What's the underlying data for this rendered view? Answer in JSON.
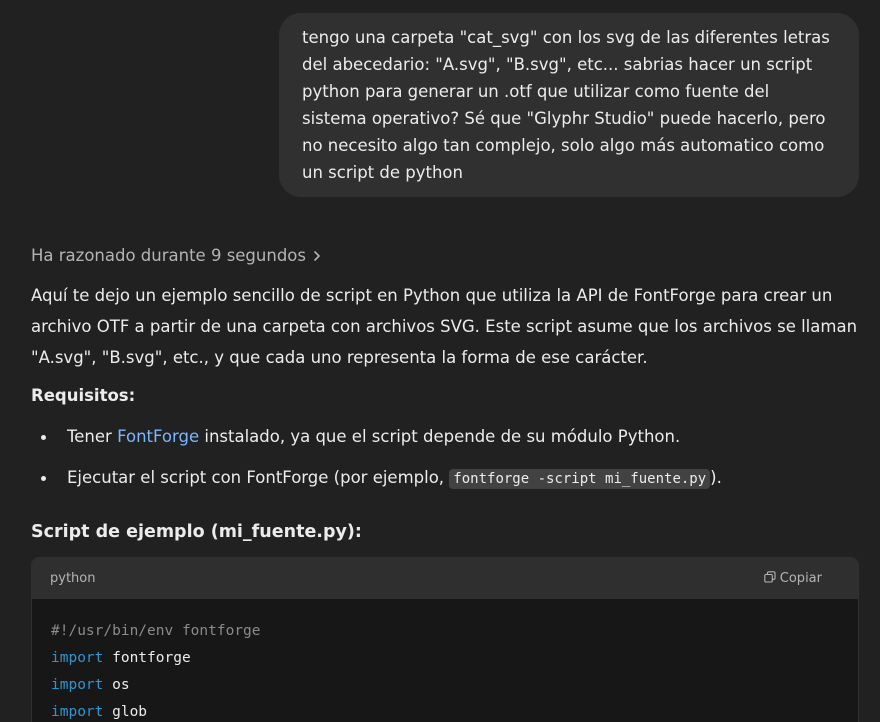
{
  "user_message": "tengo una carpeta \"cat_svg\" con los svg de las diferentes letras\ndel abecedario: \"A.svg\", \"B.svg\", etc... sabrias hacer un script\npython para generar un .otf que utilizar como fuente del\nsistema operativo? Sé que \"Glyphr Studio\" puede hacerlo, pero\nno necesito algo tan complejo, solo algo más automatico como\nun script de python",
  "reasoning": {
    "label": "Ha razonado durante 9 segundos",
    "icon": "chevron-right-icon"
  },
  "intro": "Aquí te dejo un ejemplo sencillo de script en Python que utiliza la API de FontForge para crear un archivo OTF a partir de una carpeta con archivos SVG. Este script asume que los archivos se llaman \"A.svg\", \"B.svg\", etc., y que cada uno representa la forma de ese carácter.",
  "requirements": {
    "title": "Requisitos:",
    "item1": {
      "before": "Tener ",
      "link": "FontForge",
      "after": " instalado, ya que el script depende de su módulo Python."
    },
    "item2": {
      "before": "Ejecutar el script con FontForge (por ejemplo, ",
      "code": "fontforge -script mi_fuente.py",
      "after": ")."
    }
  },
  "script_title": "Script de ejemplo (mi_fuente.py):",
  "code_block": {
    "language": "python",
    "copy_label": "Copiar",
    "copy_icon": "copy-icon",
    "lines": {
      "l1": "#!/usr/bin/env fontforge",
      "l2_kw": "import",
      "l2_rest": " fontforge",
      "l3_kw": "import",
      "l3_rest": " os",
      "l4_kw": "import",
      "l4_rest": " glob"
    }
  },
  "colors": {
    "background": "#212121",
    "user_bubble": "#303030",
    "link": "#7ab7ff",
    "code_keyword": "#2e95d3",
    "code_comment": "#8b8b8b"
  }
}
